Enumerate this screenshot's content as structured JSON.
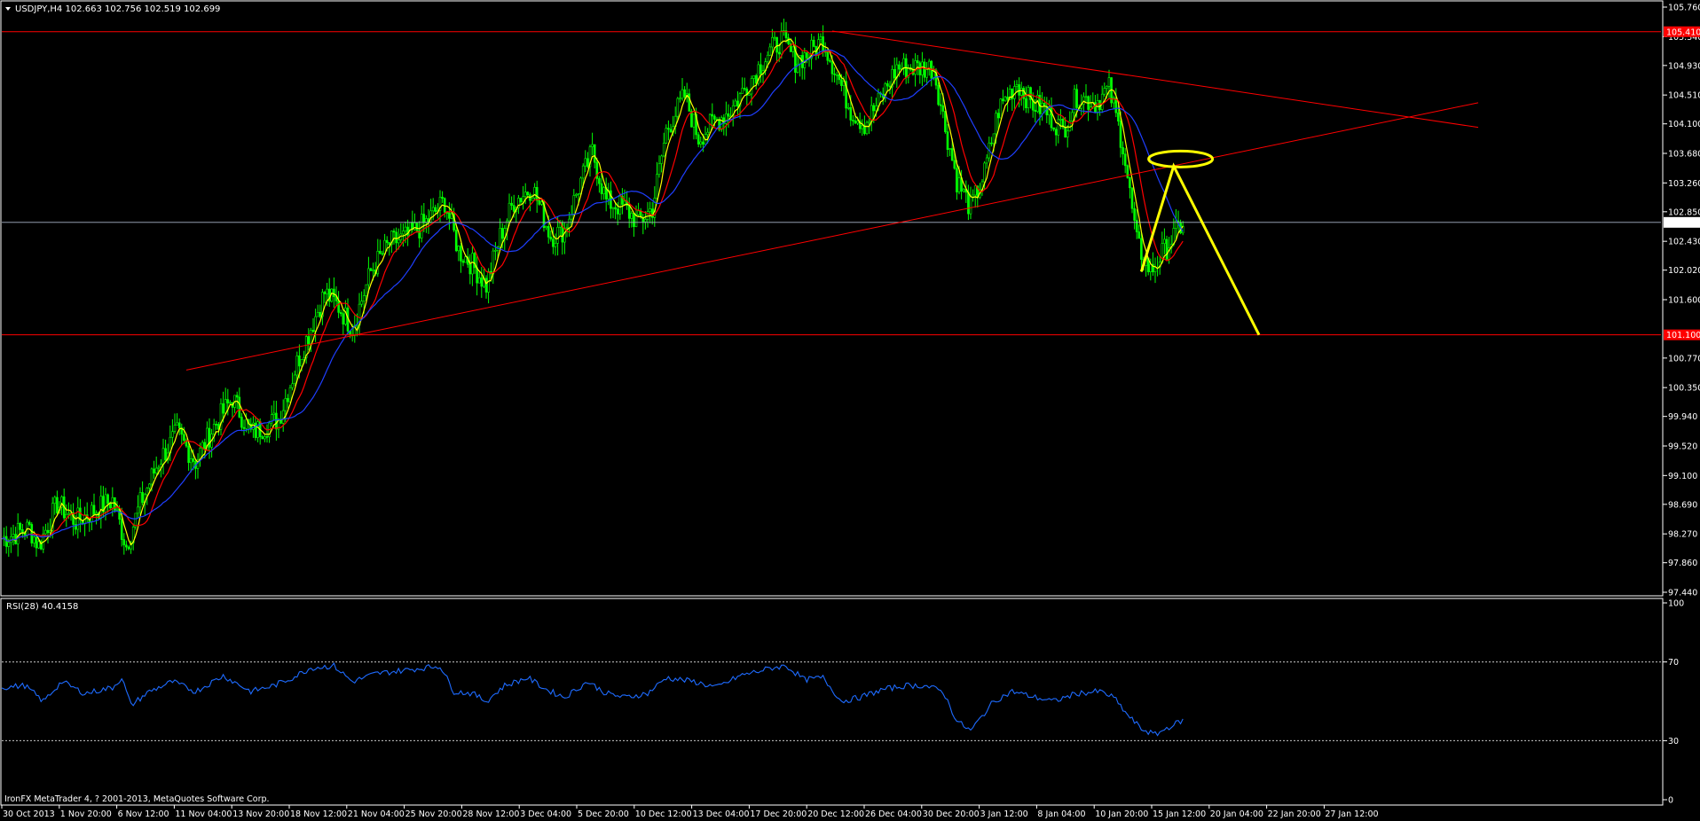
{
  "window": {
    "symbol_header": "USDJPY,H4  102.663 102.756 102.519 102.699",
    "copyright": "IronFX MetaTrader 4, ? 2001-2013, MetaQuotes Software Corp."
  },
  "colors": {
    "background": "#000000",
    "candle": "#00ff00",
    "ma_fast": "#ffff00",
    "ma_mid": "#ff0000",
    "ma_slow": "#1f3fff",
    "trendline": "#ff0000",
    "projection": "#ffff00",
    "rsi": "#1e6bff",
    "price_label": "#ffffff"
  },
  "chart_data": [
    {
      "type": "candlestick",
      "title": "USDJPY,H4",
      "y_axis_ticks": [
        "105.760",
        "105.340",
        "104.930",
        "104.510",
        "104.100",
        "103.680",
        "103.260",
        "102.850",
        "102.430",
        "102.020",
        "101.600",
        "100.770",
        "100.350",
        "99.940",
        "99.520",
        "99.100",
        "98.690",
        "98.270",
        "97.860",
        "97.440"
      ],
      "ylim": [
        97.44,
        105.76
      ],
      "x_axis_ticks": [
        "30 Oct 2013",
        "1 Nov 20:00",
        "6 Nov 12:00",
        "11 Nov 04:00",
        "13 Nov 20:00",
        "18 Nov 12:00",
        "21 Nov 04:00",
        "25 Nov 20:00",
        "28 Nov 12:00",
        "3 Dec 04:00",
        "5 Dec 20:00",
        "10 Dec 12:00",
        "13 Dec 04:00",
        "17 Dec 20:00",
        "20 Dec 12:00",
        "26 Dec 04:00",
        "30 Dec 20:00",
        "3 Jan 12:00",
        "8 Jan 04:00",
        "10 Jan 20:00",
        "15 Jan 12:00",
        "20 Jan 04:00",
        "22 Jan 20:00",
        "27 Jan 12:00"
      ],
      "last_close": "102.699",
      "top_level_label": "105.410",
      "support_level_label": "101.100",
      "horizontal_levels": [
        105.41,
        101.1,
        102.699
      ],
      "price_path": [
        {
          "i": 0,
          "p": 98.2
        },
        {
          "i": 12,
          "p": 98.35
        },
        {
          "i": 16,
          "p": 98.1
        },
        {
          "i": 24,
          "p": 98.7
        },
        {
          "i": 32,
          "p": 98.45
        },
        {
          "i": 40,
          "p": 98.6
        },
        {
          "i": 48,
          "p": 98.75
        },
        {
          "i": 54,
          "p": 98.1
        },
        {
          "i": 60,
          "p": 98.7
        },
        {
          "i": 68,
          "p": 99.3
        },
        {
          "i": 76,
          "p": 99.7
        },
        {
          "i": 84,
          "p": 99.3
        },
        {
          "i": 92,
          "p": 99.8
        },
        {
          "i": 100,
          "p": 100.2
        },
        {
          "i": 108,
          "p": 99.7
        },
        {
          "i": 114,
          "p": 99.8
        },
        {
          "i": 120,
          "p": 99.9
        },
        {
          "i": 128,
          "p": 100.7
        },
        {
          "i": 134,
          "p": 101.2
        },
        {
          "i": 140,
          "p": 101.7
        },
        {
          "i": 146,
          "p": 101.5
        },
        {
          "i": 152,
          "p": 101.2
        },
        {
          "i": 160,
          "p": 102.0
        },
        {
          "i": 168,
          "p": 102.4
        },
        {
          "i": 176,
          "p": 102.5
        },
        {
          "i": 184,
          "p": 102.7
        },
        {
          "i": 192,
          "p": 103.0
        },
        {
          "i": 198,
          "p": 102.3
        },
        {
          "i": 204,
          "p": 102.1
        },
        {
          "i": 210,
          "p": 101.8
        },
        {
          "i": 216,
          "p": 102.5
        },
        {
          "i": 222,
          "p": 103.0
        },
        {
          "i": 230,
          "p": 103.2
        },
        {
          "i": 238,
          "p": 102.5
        },
        {
          "i": 244,
          "p": 102.6
        },
        {
          "i": 250,
          "p": 103.2
        },
        {
          "i": 256,
          "p": 103.7
        },
        {
          "i": 262,
          "p": 103.0
        },
        {
          "i": 270,
          "p": 102.9
        },
        {
          "i": 276,
          "p": 102.7
        },
        {
          "i": 282,
          "p": 102.9
        },
        {
          "i": 288,
          "p": 104.0
        },
        {
          "i": 296,
          "p": 104.5
        },
        {
          "i": 302,
          "p": 103.9
        },
        {
          "i": 308,
          "p": 104.1
        },
        {
          "i": 316,
          "p": 104.3
        },
        {
          "i": 324,
          "p": 104.7
        },
        {
          "i": 332,
          "p": 105.1
        },
        {
          "i": 338,
          "p": 105.3
        },
        {
          "i": 344,
          "p": 105.0
        },
        {
          "i": 350,
          "p": 105.1
        },
        {
          "i": 356,
          "p": 105.3
        },
        {
          "i": 362,
          "p": 104.8
        },
        {
          "i": 368,
          "p": 104.3
        },
        {
          "i": 374,
          "p": 104.1
        },
        {
          "i": 380,
          "p": 104.4
        },
        {
          "i": 388,
          "p": 104.9
        },
        {
          "i": 396,
          "p": 104.9
        },
        {
          "i": 404,
          "p": 104.9
        },
        {
          "i": 408,
          "p": 104.2
        },
        {
          "i": 414,
          "p": 103.3
        },
        {
          "i": 420,
          "p": 102.9
        },
        {
          "i": 426,
          "p": 103.4
        },
        {
          "i": 432,
          "p": 104.3
        },
        {
          "i": 440,
          "p": 104.7
        },
        {
          "i": 446,
          "p": 104.4
        },
        {
          "i": 452,
          "p": 104.3
        },
        {
          "i": 460,
          "p": 104.0
        },
        {
          "i": 466,
          "p": 104.5
        },
        {
          "i": 474,
          "p": 104.4
        },
        {
          "i": 480,
          "p": 104.6
        },
        {
          "i": 486,
          "p": 103.8
        },
        {
          "i": 492,
          "p": 102.4
        },
        {
          "i": 498,
          "p": 102.0
        },
        {
          "i": 504,
          "p": 102.3
        },
        {
          "i": 512,
          "p": 102.7
        }
      ],
      "trendlines": [
        {
          "name": "rising support",
          "from": {
            "i": 80,
            "p": 100.6
          },
          "to": {
            "i": 640,
            "p": 104.4
          }
        },
        {
          "name": "falling resistance",
          "from": {
            "i": 360,
            "p": 105.42
          },
          "to": {
            "i": 640,
            "p": 104.05
          }
        }
      ],
      "projection": [
        {
          "i": 494,
          "p": 102.0
        },
        {
          "i": 508,
          "p": 103.5
        },
        {
          "i": 545,
          "p": 101.1
        }
      ],
      "target_ellipse_center": {
        "i": 511,
        "p": 103.6
      }
    },
    {
      "type": "line",
      "title": "RSI(28) 40.4158",
      "y_axis_ticks": [
        "100",
        "70",
        "30",
        "0"
      ],
      "ylim": [
        0,
        100
      ],
      "levels": [
        70,
        30
      ],
      "rsi_path": [
        {
          "i": 0,
          "v": 57
        },
        {
          "i": 10,
          "v": 58
        },
        {
          "i": 18,
          "v": 50
        },
        {
          "i": 26,
          "v": 60
        },
        {
          "i": 36,
          "v": 54
        },
        {
          "i": 48,
          "v": 57
        },
        {
          "i": 52,
          "v": 62
        },
        {
          "i": 56,
          "v": 48
        },
        {
          "i": 64,
          "v": 55
        },
        {
          "i": 74,
          "v": 60
        },
        {
          "i": 84,
          "v": 55
        },
        {
          "i": 96,
          "v": 63
        },
        {
          "i": 108,
          "v": 55
        },
        {
          "i": 118,
          "v": 58
        },
        {
          "i": 126,
          "v": 62
        },
        {
          "i": 134,
          "v": 67
        },
        {
          "i": 144,
          "v": 68
        },
        {
          "i": 152,
          "v": 60
        },
        {
          "i": 162,
          "v": 64
        },
        {
          "i": 176,
          "v": 66
        },
        {
          "i": 190,
          "v": 68
        },
        {
          "i": 196,
          "v": 55
        },
        {
          "i": 204,
          "v": 54
        },
        {
          "i": 210,
          "v": 50
        },
        {
          "i": 218,
          "v": 58
        },
        {
          "i": 228,
          "v": 62
        },
        {
          "i": 236,
          "v": 56
        },
        {
          "i": 244,
          "v": 52
        },
        {
          "i": 254,
          "v": 60
        },
        {
          "i": 262,
          "v": 54
        },
        {
          "i": 270,
          "v": 52
        },
        {
          "i": 280,
          "v": 54
        },
        {
          "i": 288,
          "v": 62
        },
        {
          "i": 300,
          "v": 60
        },
        {
          "i": 310,
          "v": 57
        },
        {
          "i": 320,
          "v": 63
        },
        {
          "i": 334,
          "v": 67
        },
        {
          "i": 340,
          "v": 68
        },
        {
          "i": 348,
          "v": 61
        },
        {
          "i": 356,
          "v": 62
        },
        {
          "i": 364,
          "v": 50
        },
        {
          "i": 372,
          "v": 52
        },
        {
          "i": 382,
          "v": 56
        },
        {
          "i": 392,
          "v": 58
        },
        {
          "i": 400,
          "v": 58
        },
        {
          "i": 408,
          "v": 55
        },
        {
          "i": 414,
          "v": 40
        },
        {
          "i": 420,
          "v": 35
        },
        {
          "i": 430,
          "v": 50
        },
        {
          "i": 438,
          "v": 55
        },
        {
          "i": 448,
          "v": 52
        },
        {
          "i": 456,
          "v": 50
        },
        {
          "i": 466,
          "v": 54
        },
        {
          "i": 476,
          "v": 55
        },
        {
          "i": 482,
          "v": 52
        },
        {
          "i": 488,
          "v": 43
        },
        {
          "i": 494,
          "v": 36
        },
        {
          "i": 500,
          "v": 33
        },
        {
          "i": 506,
          "v": 37
        },
        {
          "i": 512,
          "v": 40.4
        }
      ]
    }
  ]
}
